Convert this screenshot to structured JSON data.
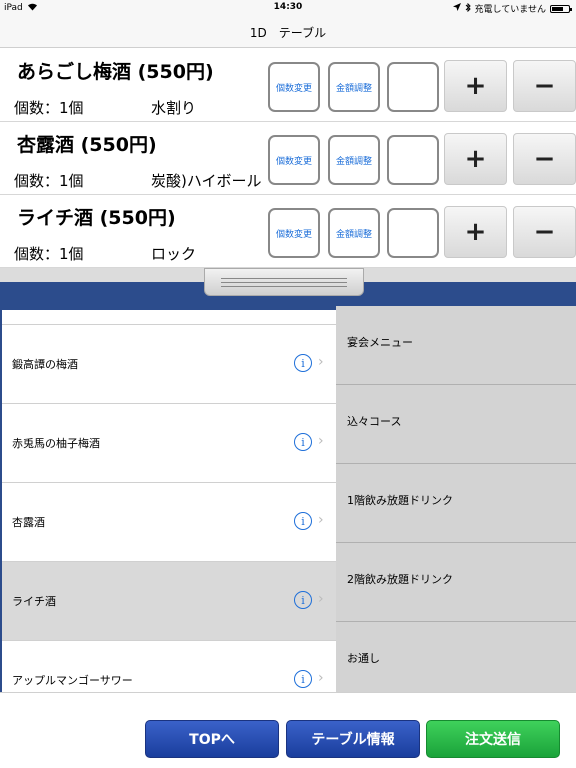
{
  "status_bar": {
    "device": "iPad",
    "time": "14:30",
    "charging": "充電していません"
  },
  "nav": {
    "title": "1D　テーブル"
  },
  "order_buttons": {
    "change_qty": "個数変更",
    "adjust_price": "金額調整",
    "plus": "+",
    "minus": "−"
  },
  "orders": [
    {
      "name": "あらごし梅酒 (550円)",
      "qty": "個数：1個",
      "style": "水割り"
    },
    {
      "name": "杏露酒 (550円)",
      "qty": "個数：1個",
      "style": "炭酸)ハイボール"
    },
    {
      "name": "ライチ酒 (550円)",
      "qty": "個数：1個",
      "style": "ロック"
    }
  ],
  "items": [
    {
      "label": "鍛高譚の梅酒"
    },
    {
      "label": "赤兎馬の柚子梅酒"
    },
    {
      "label": "杏露酒"
    },
    {
      "label": "ライチ酒"
    },
    {
      "label": "アップルマンゴーサワー"
    }
  ],
  "info_glyph": "i",
  "chevron_glyph": "›",
  "categories": [
    {
      "label": "宴会メニュー"
    },
    {
      "label": "込々コース"
    },
    {
      "label": "1階飲み放題ドリンク"
    },
    {
      "label": "2階飲み放題ドリンク"
    },
    {
      "label": "お通し"
    }
  ],
  "bottom": {
    "top_label": "TOPへ",
    "table_info_label": "テーブル情報",
    "send_order_label": "注文送信"
  },
  "colors": {
    "accent_blue": "#1e6fd9",
    "band_blue": "#2c4c8c",
    "button_blue": "#1a3e9d",
    "button_green": "#1aa33a",
    "selected_row": "#d9d9d9"
  },
  "battery_level": 0.7
}
